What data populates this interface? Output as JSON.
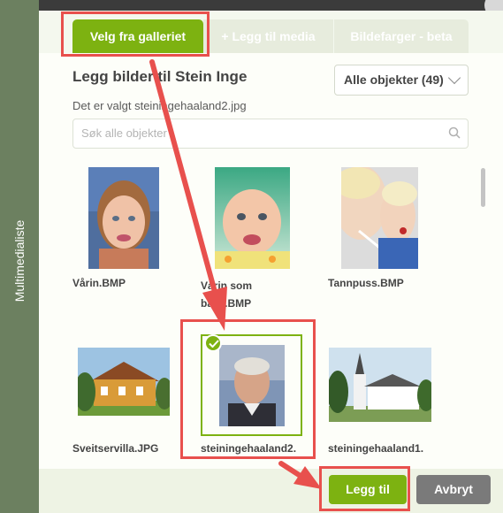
{
  "sidebar": {
    "label": "Multimedialiste"
  },
  "tabs": [
    {
      "label": "Velg fra galleriet",
      "active": true
    },
    {
      "label": "+ Legg til media",
      "active": false
    },
    {
      "label": "Bildefarger - beta",
      "active": false
    }
  ],
  "header": {
    "title": "Legg bilder til Stein Inge",
    "selected_text": "Det er valgt steiningehaaland2.jpg"
  },
  "filter": {
    "selected": "Alle objekter (49)"
  },
  "search": {
    "placeholder": "Søk alle objekter"
  },
  "gallery": [
    {
      "name": "Vårin.BMP",
      "selected": false
    },
    {
      "name": "Vårin som baby.BMP",
      "selected": false
    },
    {
      "name": "Tannpuss.BMP",
      "selected": false
    },
    {
      "name": "Sveitservilla.JPG",
      "selected": false
    },
    {
      "name": "steiningehaaland2.",
      "selected": true
    },
    {
      "name": "steiningehaaland1.",
      "selected": false
    }
  ],
  "buttons": {
    "add": "Legg til",
    "cancel": "Avbryt"
  },
  "colors": {
    "accent": "#7db211",
    "sidebar": "#6c8060",
    "annotation": "#e8504d",
    "cancel": "#7a7a7a"
  }
}
